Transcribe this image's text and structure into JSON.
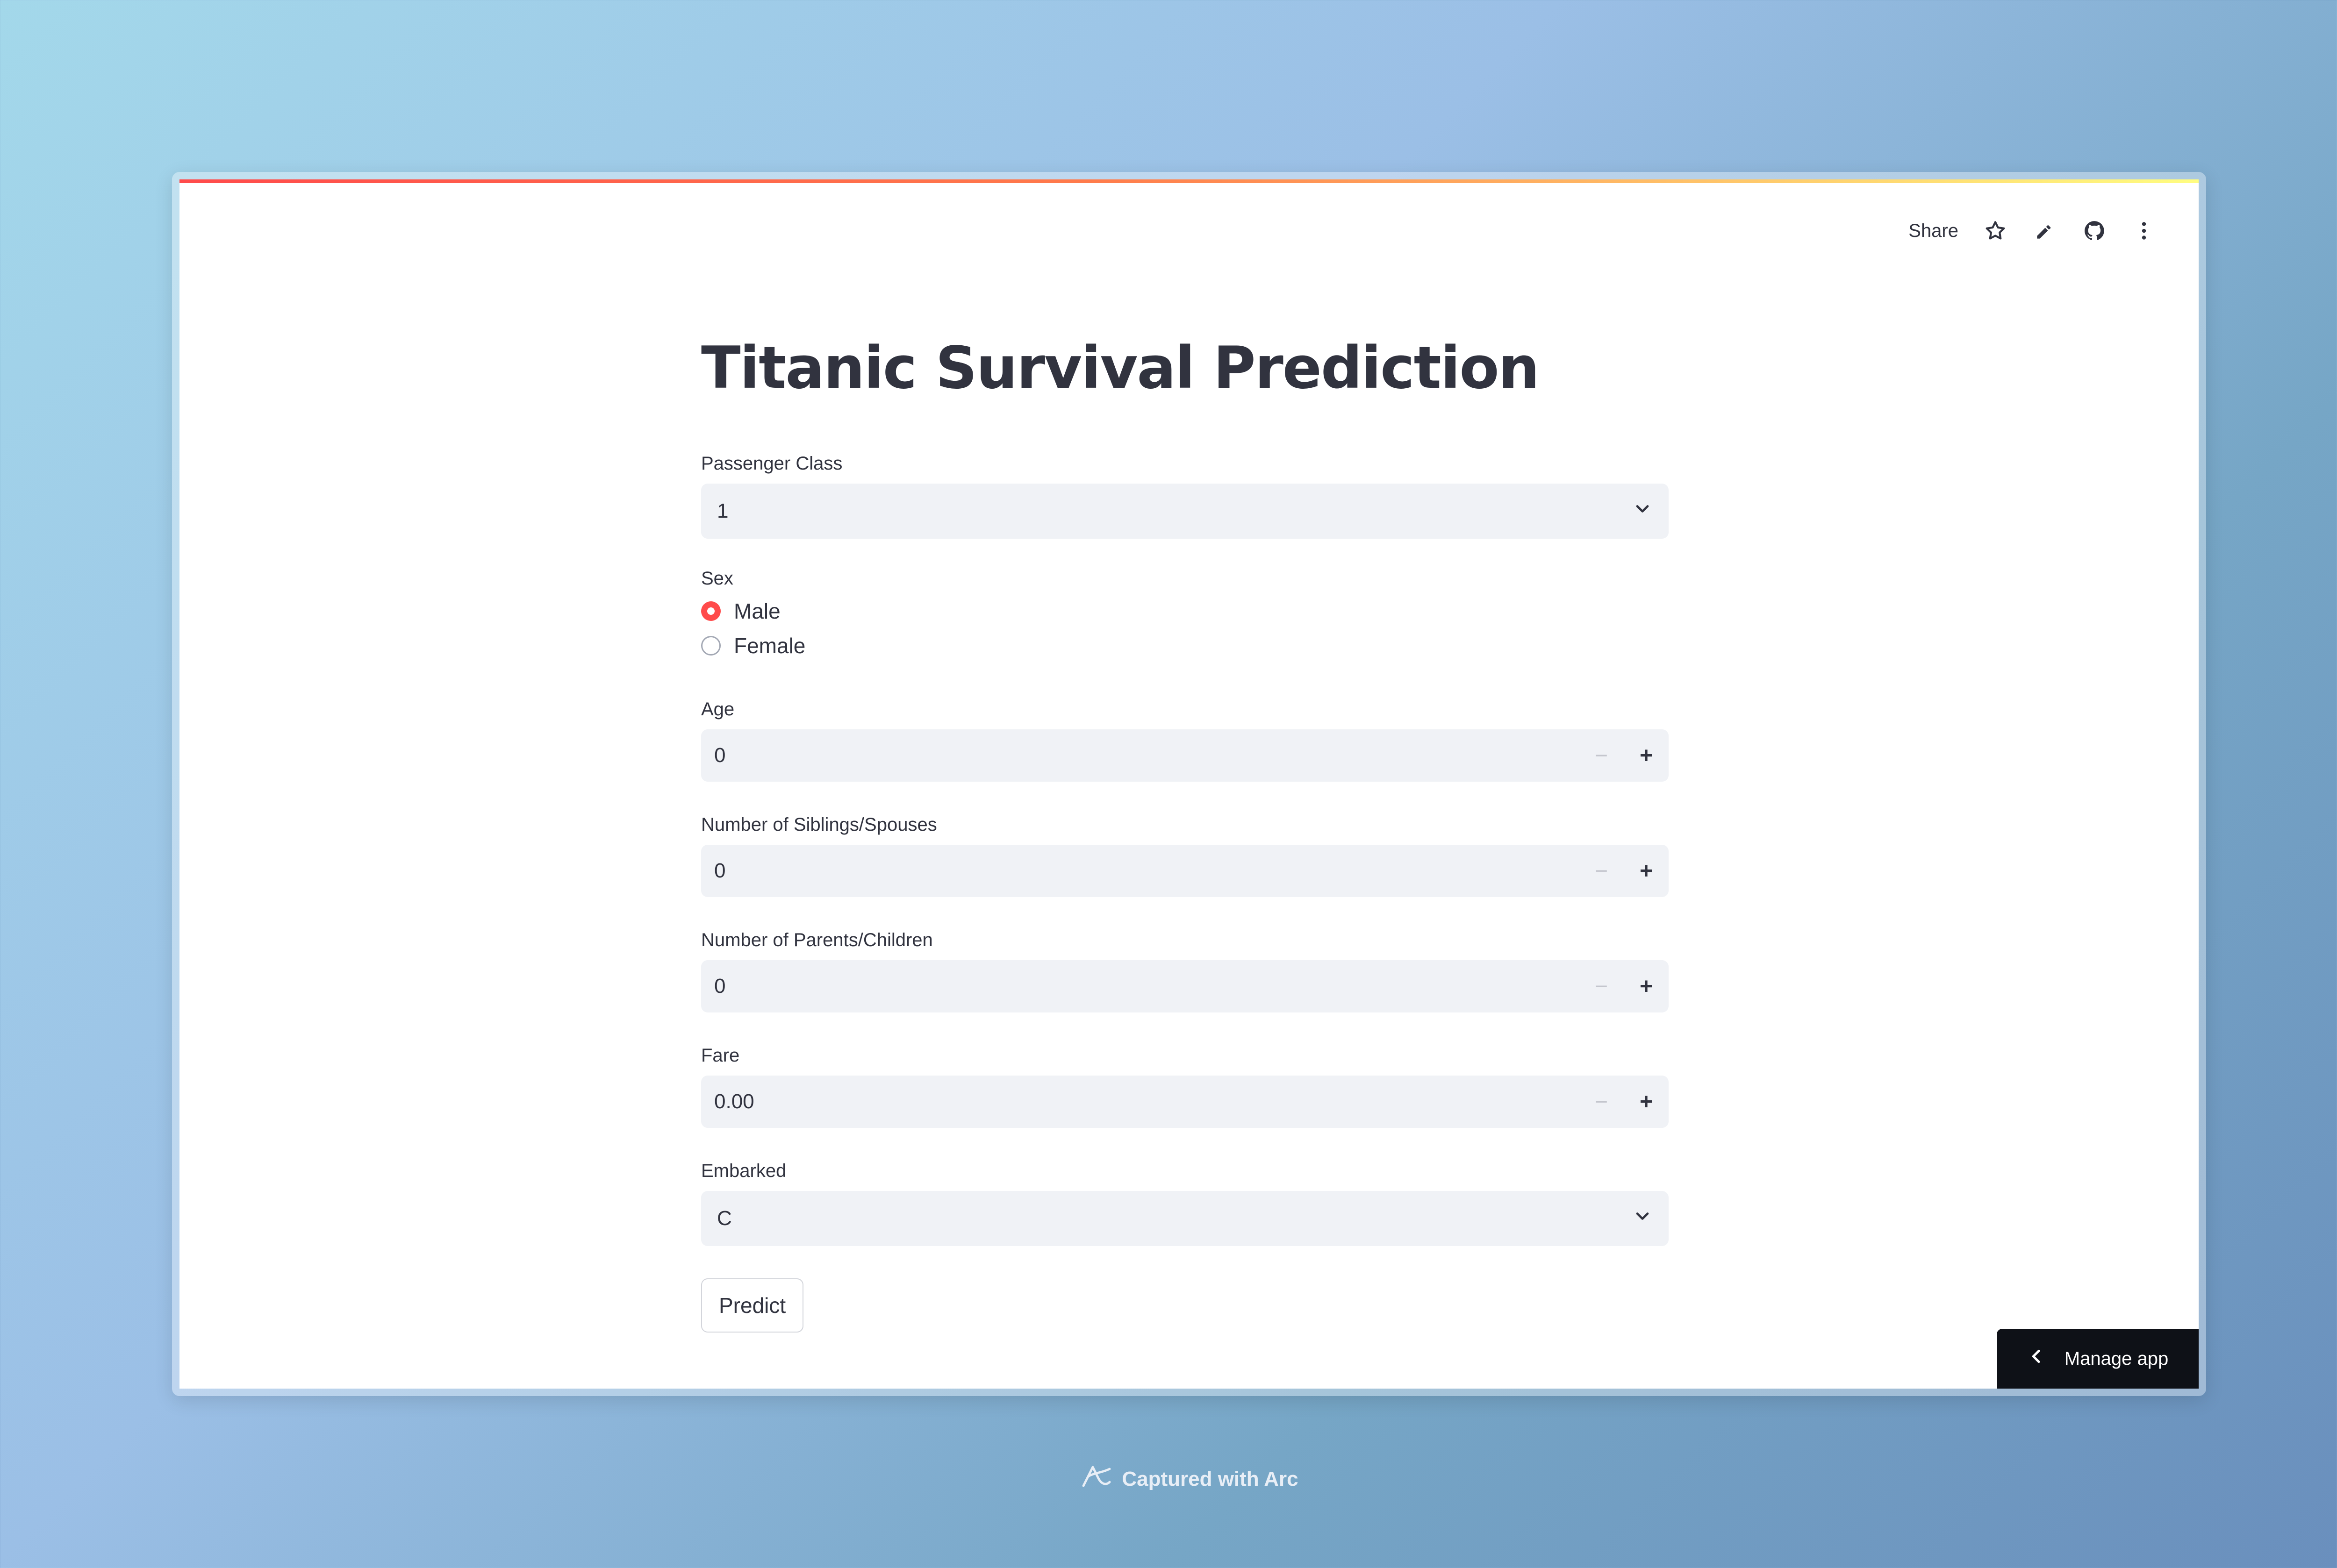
{
  "toolbar": {
    "share_label": "Share",
    "icons": [
      "star-icon",
      "pencil-icon",
      "github-icon",
      "more-vertical-icon"
    ]
  },
  "title": "Titanic Survival Prediction",
  "form": {
    "passenger_class": {
      "label": "Passenger Class",
      "value": "1"
    },
    "sex": {
      "label": "Sex",
      "options": [
        {
          "label": "Male",
          "selected": true
        },
        {
          "label": "Female",
          "selected": false
        }
      ]
    },
    "age": {
      "label": "Age",
      "value": "0"
    },
    "siblings_spouses": {
      "label": "Number of Siblings/Spouses",
      "value": "0"
    },
    "parents_children": {
      "label": "Number of Parents/Children",
      "value": "0"
    },
    "fare": {
      "label": "Fare",
      "value": "0.00"
    },
    "embarked": {
      "label": "Embarked",
      "value": "C"
    },
    "predict_label": "Predict"
  },
  "manage_app_label": "Manage app",
  "footer_caption": "Captured with Arc",
  "colors": {
    "accent": "#ff4b4b",
    "input_bg": "#f0f2f6",
    "text": "#31333f",
    "manage_bg": "#0e1117"
  }
}
